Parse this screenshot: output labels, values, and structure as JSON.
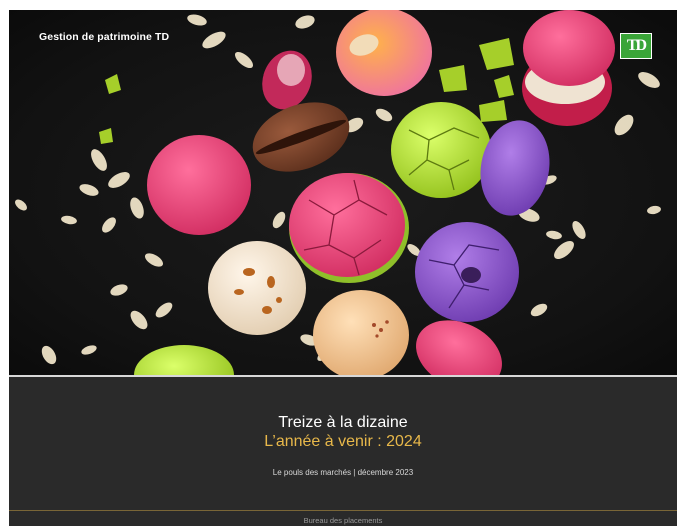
{
  "header": {
    "brand": "Gestion de patrimoine TD",
    "logo_text": "TD"
  },
  "cover": {
    "title_line1": "Treize à la dizaine",
    "title_line2": "L’année à venir : 2024",
    "subtitle": "Le pouls des marchés | décembre 2023",
    "footer": "Bureau des placements"
  },
  "colors": {
    "panel": "#2a2a2a",
    "accent_gold": "#e8b84a",
    "td_green": "#3aa538"
  },
  "icons": [
    "td-logo-icon"
  ]
}
